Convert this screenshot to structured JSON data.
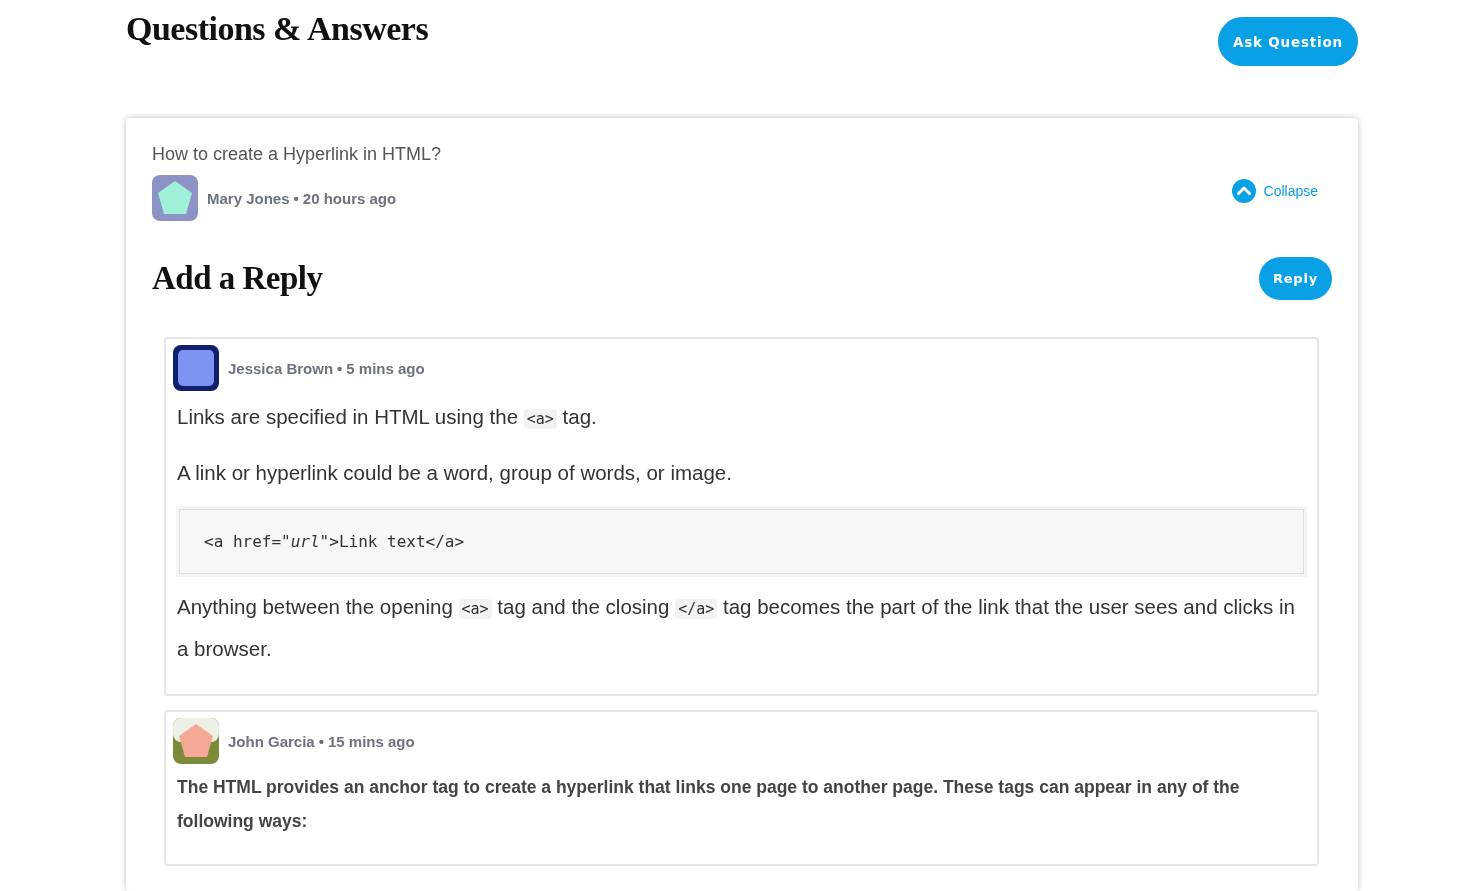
{
  "page_title": "Questions & Answers",
  "ask_button": "Ask Question",
  "meta_separator": "•",
  "question": {
    "title": "How to create a Hyperlink in HTML?",
    "author": "Mary Jones",
    "time": "20 hours ago",
    "collapse": "Collapse",
    "expanded": true
  },
  "reply_heading": "Add a Reply",
  "reply_button": "Reply",
  "replies": [
    {
      "author": "Jessica Brown",
      "time": "5 mins ago",
      "blocks": [
        {
          "kind": "paragraph",
          "parts": [
            {
              "kind": "text",
              "text": "Links are specified in HTML using the "
            },
            {
              "kind": "code",
              "text": "<a>"
            },
            {
              "kind": "text",
              "text": " tag."
            }
          ]
        },
        {
          "kind": "paragraph",
          "parts": [
            {
              "kind": "text",
              "text": "A link or hyperlink could be a word, group of words, or image."
            }
          ]
        },
        {
          "kind": "codeblock",
          "text": "<a href=\"*url*\">Link text</a>"
        },
        {
          "kind": "paragraph",
          "parts": [
            {
              "kind": "text",
              "text": "Anything between the opening "
            },
            {
              "kind": "code",
              "text": "<a>"
            },
            {
              "kind": "text",
              "text": " tag and the closing "
            },
            {
              "kind": "code",
              "text": "</a>"
            },
            {
              "kind": "text",
              "text": " tag becomes the part of the link that the user sees and clicks in a browser."
            }
          ]
        }
      ]
    },
    {
      "author": "John Garcia",
      "time": "15 mins ago",
      "blocks": [
        {
          "kind": "bold",
          "parts": [
            {
              "kind": "text",
              "text": "The HTML provides an anchor tag to create a hyperlink that links one page to another page. These tags can appear in any of the following ways:"
            }
          ]
        }
      ]
    }
  ]
}
